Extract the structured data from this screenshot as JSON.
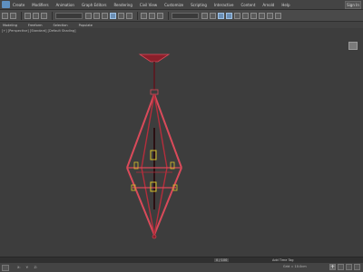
{
  "menubar": {
    "items": [
      "Create",
      "Modifiers",
      "Animation",
      "Graph Editors",
      "Rendering",
      "Civil View",
      "Customize",
      "Scripting",
      "Interactive",
      "Content",
      "Arnold",
      "Help"
    ],
    "signin_label": "Sign In"
  },
  "ribbon": {
    "tabs": [
      "Modeling",
      "Freeform",
      "Selection",
      "Populate"
    ]
  },
  "viewport": {
    "label": "[+] [Perspective] [Standard] [Default Shading]"
  },
  "timebar": {
    "frame_counter": "0 / 100",
    "add_time_tag": "Add Time Tag"
  },
  "statusbar": {
    "status_text": "",
    "x_label": "X:",
    "y_label": "Y:",
    "z_label": "Z:",
    "grid_text": "Grid = 10.0cm"
  },
  "colors": {
    "model_body": "#8a1f2a",
    "model_edge": "#d94a5a",
    "model_accent": "#d8c12a",
    "viewport_bg": "#3d3d3d"
  }
}
